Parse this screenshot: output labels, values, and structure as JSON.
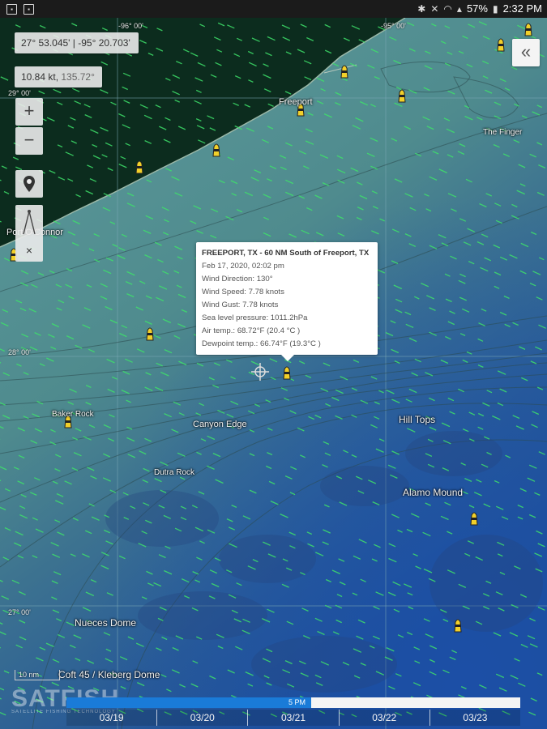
{
  "statusbar": {
    "battery": "57%",
    "time": "2:32 PM"
  },
  "controls": {
    "coordinates": "27° 53.045' | -95° 20.703'",
    "speed": "10.84 kt",
    "heading": "135.72°",
    "zoom_in": "+",
    "zoom_out": "−",
    "close": "×",
    "collapse": "«"
  },
  "grid_labels": {
    "lon_96": "-96° 00'",
    "lon_95": "-95° 00'",
    "lat_29": "29° 00'",
    "lat_28": "28° 00'",
    "lat_27": "27° 00'"
  },
  "places": {
    "freeport": "Freeport",
    "the_finger": "The Finger",
    "port_oconnor": "Port O'Connor",
    "baker_rock": "Baker Rock",
    "canyon_edge": "Canyon Edge",
    "hill_tops": "Hill Tops",
    "dutra_rock": "Dutra Rock",
    "alamo_mound": "Alamo Mound",
    "nueces_dome": "Nueces Dome",
    "coft_kleberg": "Coft 45 / Kleberg Dome"
  },
  "popup": {
    "title": "FREEPORT, TX - 60 NM South of Freeport, TX",
    "datetime": "Feb 17, 2020, 02:02 pm",
    "wind_direction": "Wind Direction: 130°",
    "wind_speed": "Wind Speed: 7.78 knots",
    "wind_gust": "Wind Gust: 7.78 knots",
    "pressure": "Sea level pressure: 1011.2hPa",
    "air_temp": "Air temp.: 68.72°F (20.4 °C )",
    "dewpoint": "Dewpoint temp.: 66.74°F (19.3°C )"
  },
  "scale": "10 nm",
  "logo": {
    "brand": "SATFISH",
    "tagline": "SATELLITE FISHING TECHNOLOGY"
  },
  "timeline": {
    "current_time": "5 PM",
    "progress": 0.54,
    "dates": [
      "03/19",
      "03/20",
      "03/21",
      "03/22",
      "03/23"
    ]
  },
  "colors": {
    "land": "#0c2c1e",
    "shelf": "#4f8b8e",
    "deep": "#1f4f97",
    "wind": "#3ee06a",
    "timeline_blue": "#1a7bd8",
    "buoy": "#f2d02a"
  }
}
